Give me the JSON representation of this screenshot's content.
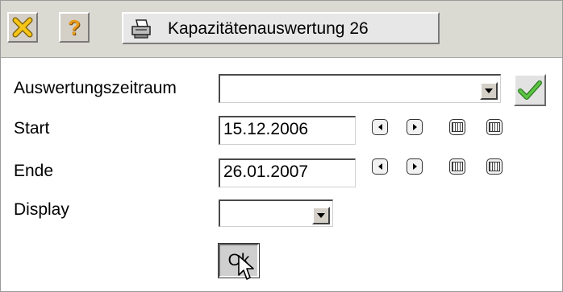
{
  "toolbar": {
    "close_icon": "close-x-icon",
    "help_label": "?",
    "print_icon": "printer-icon",
    "title": "Kapazitätenauswertung 26"
  },
  "form": {
    "period_label": "Auswertungszeitraum",
    "period_value": "",
    "start_label": "Start",
    "start_value": "15.12.2006",
    "end_label": "Ende",
    "end_value": "26.01.2007",
    "display_label": "Display",
    "display_value": "",
    "ok_label": "Ok"
  },
  "colors": {
    "toolbar_bg": "#dad9d2",
    "close_icon": "#f0b400",
    "help_icon": "#e89b1c",
    "check_icon": "#3aa02e"
  }
}
